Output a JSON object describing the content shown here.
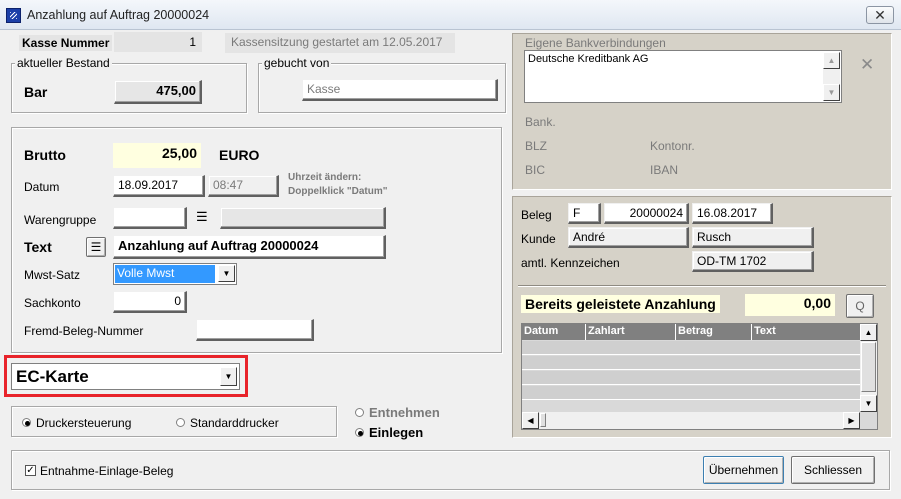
{
  "window": {
    "title": "Anzahlung auf Auftrag 20000024",
    "close_label": "✕"
  },
  "header": {
    "kasse_label": "Kasse Nummer",
    "kasse_value": "1",
    "session_text": "Kassensitzung gestartet am 12.05.2017"
  },
  "bestand": {
    "group_label": "aktueller Bestand",
    "bar_label": "Bar",
    "bar_value": "475,00"
  },
  "gebucht": {
    "group_label": "gebucht von",
    "value": "Kasse"
  },
  "form": {
    "brutto_label": "Brutto",
    "brutto_value": "25,00",
    "currency": "EURO",
    "datum_label": "Datum",
    "datum_value": "18.09.2017",
    "time_value": "08:47",
    "time_hint_line1": "Uhrzeit ändern:",
    "time_hint_line2": "Doppelklick \"Datum\"",
    "warengruppe_label": "Warengruppe",
    "warengruppe_value": "",
    "warengruppe_desc": "",
    "text_label": "Text",
    "text_value": "Anzahlung auf Auftrag 20000024",
    "mwst_label": "Mwst-Satz",
    "mwst_value": "Volle Mwst",
    "sachkonto_label": "Sachkonto",
    "sachkonto_value": "0",
    "fremd_label": "Fremd-Beleg-Nummer",
    "fremd_value": ""
  },
  "payment": {
    "selected": "EC-Karte"
  },
  "printer": {
    "option1": "Druckersteuerung",
    "option2": "Standarddrucker",
    "selected": "Druckersteuerung"
  },
  "mode": {
    "option1": "Entnehmen",
    "option2": "Einlegen",
    "selected": "Einlegen"
  },
  "bank": {
    "group_label": "Eigene Bankverbindungen",
    "list_item": "Deutsche Kreditbank AG",
    "bank_label": "Bank.",
    "blz_label": "BLZ",
    "kontonr_label": "Kontonr.",
    "bic_label": "BIC",
    "iban_label": "IBAN"
  },
  "beleg": {
    "beleg_label": "Beleg",
    "beleg_type": "F",
    "beleg_number": "20000024",
    "beleg_date": "16.08.2017",
    "kunde_label": "Kunde",
    "kunde_first": "André",
    "kunde_last": "Rusch",
    "kennzeichen_label": "amtl. Kennzeichen",
    "kennzeichen_value": "OD-TM 1702"
  },
  "anzahlung": {
    "label": "Bereits geleistete Anzahlung",
    "value": "0,00",
    "query_button": "Q",
    "columns": [
      "Datum",
      "Zahlart",
      "Betrag",
      "Text"
    ]
  },
  "footer": {
    "checkbox_label": "Entnahme-Einlage-Beleg",
    "checkbox_checked": true,
    "ok_button": "Übernehmen",
    "cancel_button": "Schliessen"
  },
  "colors": {
    "highlight_red": "#e8232a",
    "selection_blue": "#3399ff",
    "panel_tan": "#d6d2c8",
    "field_yellow": "#ffffe0"
  }
}
